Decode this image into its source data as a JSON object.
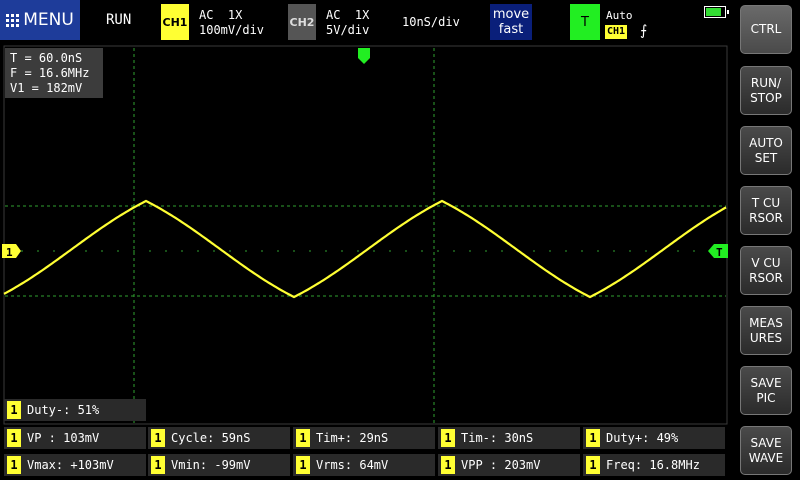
{
  "header": {
    "menu_label": "MENU",
    "run_state": "RUN",
    "ch1": {
      "label": "CH1",
      "coupling": "AC  1X",
      "scale": "100mV/div"
    },
    "ch2": {
      "label": "CH2",
      "coupling": "AC  1X",
      "scale": "5V/div"
    },
    "timebase": "10nS/div",
    "move_mode_line1": "move",
    "move_mode_line2": "fast",
    "trigger": {
      "label": "T",
      "mode": "Auto",
      "source": "CH1",
      "edge_symbol": "⨍"
    }
  },
  "readout": {
    "period": "T = 60.0nS",
    "frequency": "F = 16.6MHz",
    "voltage": "V1 = 182mV"
  },
  "markers": {
    "ch1": "1",
    "trigger": "T"
  },
  "sidebar": [
    {
      "label": "CTRL"
    },
    {
      "label": "RUN/\nSTOP"
    },
    {
      "label": "AUTO\nSET"
    },
    {
      "label": "T CU\nRSOR"
    },
    {
      "label": "V CU\nRSOR"
    },
    {
      "label": "MEAS\nURES"
    },
    {
      "label": "SAVE\nPIC"
    },
    {
      "label": "SAVE\nWAVE"
    }
  ],
  "measurements": {
    "channel": "1",
    "duty_minus": "Duty-: 51%",
    "row1": [
      "VP : 103mV",
      "Cycle: 59nS",
      "Tim+: 29nS",
      "Tim-: 30nS",
      "Duty+: 49%"
    ],
    "row2": [
      "Vmax: +103mV",
      "Vmin: -99mV",
      "Vrms: 64mV",
      "VPP : 203mV",
      "Freq: 16.8MHz"
    ]
  },
  "colors": {
    "ch1": "#ffff33",
    "trigger": "#22ee22",
    "grid": "#2fa02f",
    "accent": "#1e3c9a"
  }
}
